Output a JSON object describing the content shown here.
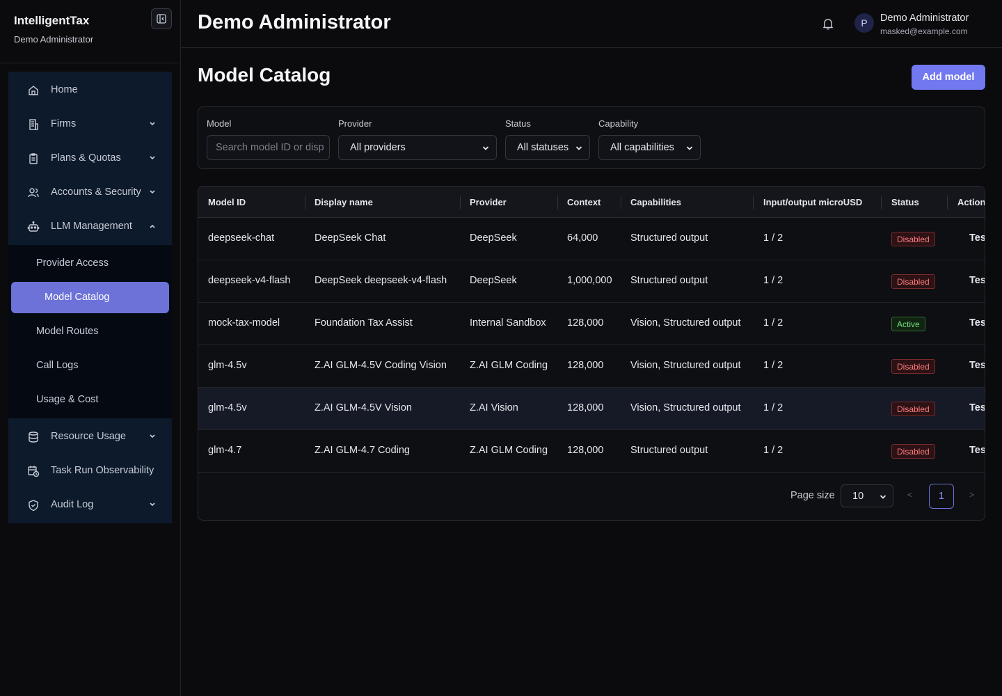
{
  "app": {
    "brand": "IntelligentTax",
    "brand_sub": "Demo Administrator"
  },
  "sidebar": {
    "items": [
      {
        "label": "Home",
        "icon": "home-icon"
      },
      {
        "label": "Firms",
        "icon": "building-icon"
      },
      {
        "label": "Plans & Quotas",
        "icon": "clipboard-icon"
      },
      {
        "label": "Accounts & Security",
        "icon": "users-icon"
      },
      {
        "label": "LLM Management",
        "icon": "robot-icon"
      }
    ],
    "llm_sub": [
      {
        "label": "Provider Access"
      },
      {
        "label": "Model Catalog"
      },
      {
        "label": "Model Routes"
      },
      {
        "label": "Call Logs"
      },
      {
        "label": "Usage & Cost"
      }
    ],
    "items2": [
      {
        "label": "Resource Usage",
        "icon": "database-icon"
      },
      {
        "label": "Task Run Observability",
        "icon": "calendar-clock-icon"
      },
      {
        "label": "Audit Log",
        "icon": "shield-check-icon"
      }
    ]
  },
  "header": {
    "title": "Demo Administrator",
    "avatar_letter": "P",
    "user_name": "Demo Administrator",
    "user_email": "masked@example.com"
  },
  "main": {
    "title": "Model Catalog",
    "add_label": "Add model"
  },
  "filters": {
    "model_label": "Model",
    "model_placeholder": "Search model ID or disp",
    "provider_label": "Provider",
    "provider_value": "All providers",
    "status_label": "Status",
    "status_value": "All statuses",
    "capability_label": "Capability",
    "capability_value": "All capabilities"
  },
  "table": {
    "headers": [
      "Model ID",
      "Display name",
      "Provider",
      "Context",
      "Capabilities",
      "Input/output microUSD",
      "Status",
      "Action"
    ],
    "rows": [
      {
        "id": "deepseek-chat",
        "name": "DeepSeek Chat",
        "provider": "DeepSeek",
        "context": "64,000",
        "caps": "Structured output",
        "io": "1 / 2",
        "status": "Disabled",
        "action": "Tes"
      },
      {
        "id": "deepseek-v4-flash",
        "name": "DeepSeek deepseek-v4-flash",
        "provider": "DeepSeek",
        "context": "1,000,000",
        "caps": "Structured output",
        "io": "1 / 2",
        "status": "Disabled",
        "action": "Tes"
      },
      {
        "id": "mock-tax-model",
        "name": "Foundation Tax Assist",
        "provider": "Internal Sandbox",
        "context": "128,000",
        "caps": "Vision, Structured output",
        "io": "1 / 2",
        "status": "Active",
        "action": "Tes"
      },
      {
        "id": "glm-4.5v",
        "name": "Z.AI GLM-4.5V Coding Vision",
        "provider": "Z.AI GLM Coding",
        "context": "128,000",
        "caps": "Vision, Structured output",
        "io": "1 / 2",
        "status": "Disabled",
        "action": "Tes"
      },
      {
        "id": "glm-4.5v",
        "name": "Z.AI GLM-4.5V Vision",
        "provider": "Z.AI Vision",
        "context": "128,000",
        "caps": "Vision, Structured output",
        "io": "1 / 2",
        "status": "Disabled",
        "action": "Tes"
      },
      {
        "id": "glm-4.7",
        "name": "Z.AI GLM-4.7 Coding",
        "provider": "Z.AI GLM Coding",
        "context": "128,000",
        "caps": "Structured output",
        "io": "1 / 2",
        "status": "Disabled",
        "action": "Tes"
      }
    ]
  },
  "pager": {
    "label": "Page size",
    "size": "10",
    "prev": "<",
    "current": "1",
    "next": ">"
  },
  "colors": {
    "accent": "#7278f0",
    "active_nav": "#6c72d8",
    "status_disabled": "#ff7a7f",
    "status_active": "#6ee07a"
  }
}
